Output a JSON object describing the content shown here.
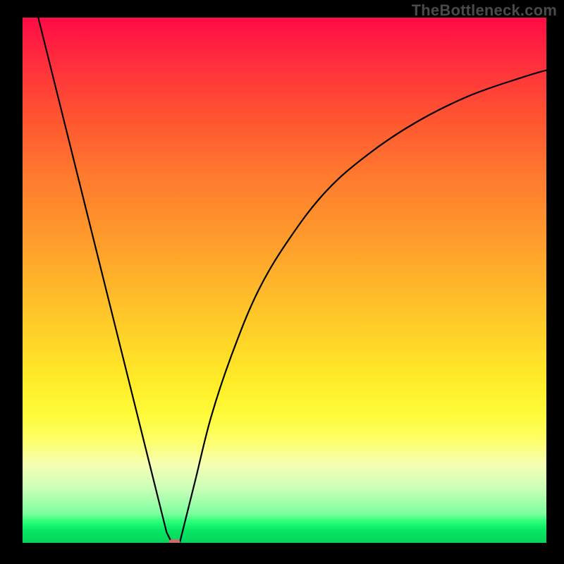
{
  "watermark": "TheBottleneck.com",
  "chart_data": {
    "type": "line",
    "title": "",
    "xlabel": "",
    "ylabel": "",
    "xlim": [
      0,
      100
    ],
    "ylim": [
      0,
      100
    ],
    "grid": false,
    "legend": false,
    "series": [
      {
        "name": "left-branch",
        "x": [
          3,
          6,
          9,
          12,
          15,
          18,
          21,
          24,
          26,
          27.5,
          28.5
        ],
        "y": [
          100,
          88,
          76,
          64,
          52,
          40,
          28,
          16,
          8,
          2,
          0
        ]
      },
      {
        "name": "right-branch",
        "x": [
          30,
          31,
          33,
          36,
          40,
          45,
          51,
          58,
          66,
          75,
          85,
          95,
          100
        ],
        "y": [
          0,
          4,
          12,
          24,
          36,
          48,
          58,
          67,
          74,
          80,
          85,
          88.5,
          90
        ]
      }
    ],
    "marker": {
      "name": "vertex-marker",
      "x": 29,
      "y": 0,
      "width": 2.2,
      "height": 1.3,
      "color": "#c96a6f"
    },
    "background_gradient": {
      "top": "#ff0b46",
      "mid_upper": "#ff9a2c",
      "mid_lower": "#ffee28",
      "bottom_transition": "#7cff9e",
      "bottom": "#05d35c"
    }
  }
}
